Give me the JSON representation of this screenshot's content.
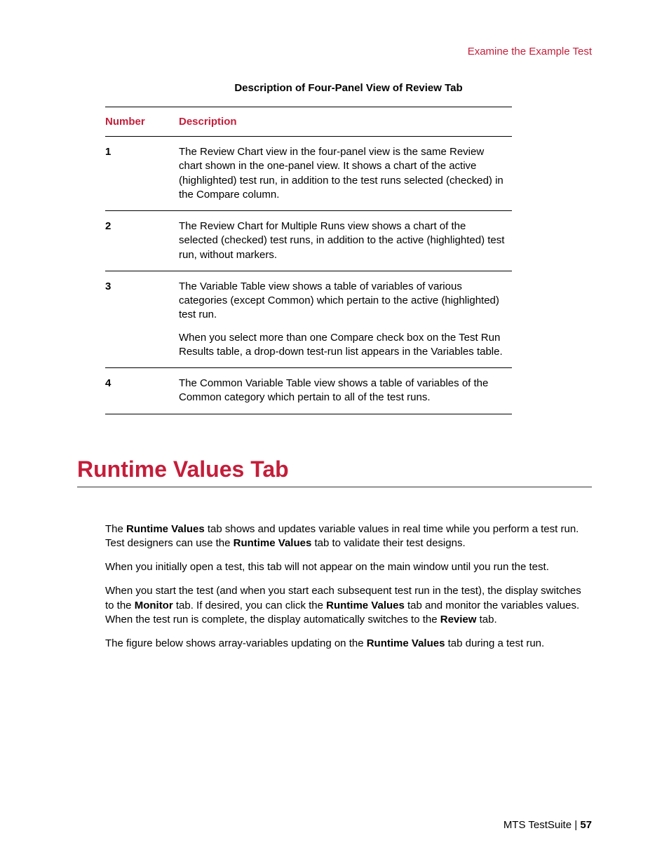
{
  "header": {
    "link": "Examine the Example Test"
  },
  "table": {
    "caption": "Description of Four-Panel View of Review Tab",
    "headers": {
      "number": "Number",
      "description": "Description"
    },
    "rows": [
      {
        "num": "1",
        "desc": [
          "The Review Chart view in the four-panel view is the same Review chart shown in the one-panel view. It shows a chart of the active (highlighted) test run, in addition to the test runs selected (checked) in the Compare column."
        ]
      },
      {
        "num": "2",
        "desc": [
          "The Review Chart for Multiple Runs view shows a chart of the selected (checked) test runs, in addition to the active (highlighted) test run, without markers."
        ]
      },
      {
        "num": "3",
        "desc": [
          "The Variable Table view shows a table of variables of various categories (except Common) which pertain to the active (highlighted) test run.",
          "When you select more than one Compare check box on the Test Run Results table, a drop-down test-run list appears in the Variables table."
        ]
      },
      {
        "num": "4",
        "desc": [
          "The Common Variable Table view shows a table of variables of the Common category which pertain to all of the test runs."
        ]
      }
    ]
  },
  "section": {
    "heading": "Runtime Values Tab",
    "p1_a": "The ",
    "p1_b": "Runtime Values",
    "p1_c": " tab shows and updates variable values in real time while you perform a test run. Test designers can use the ",
    "p1_d": "Runtime Values",
    "p1_e": " tab to validate their test designs.",
    "p2": "When you initially open a test, this tab will not appear on the main window until you run the test.",
    "p3_a": "When you start the test (and when you start each subsequent test run in the test), the display switches to the ",
    "p3_b": "Monitor",
    "p3_c": " tab. If desired, you can click the ",
    "p3_d": "Runtime Values",
    "p3_e": " tab and monitor the variables values. When the test run is complete, the display automatically switches to the ",
    "p3_f": "Review",
    "p3_g": " tab.",
    "p4_a": "The figure below shows array-variables updating on the ",
    "p4_b": "Runtime Values",
    "p4_c": " tab during a test run."
  },
  "footer": {
    "prefix": "MTS TestSuite | ",
    "page": "57"
  }
}
